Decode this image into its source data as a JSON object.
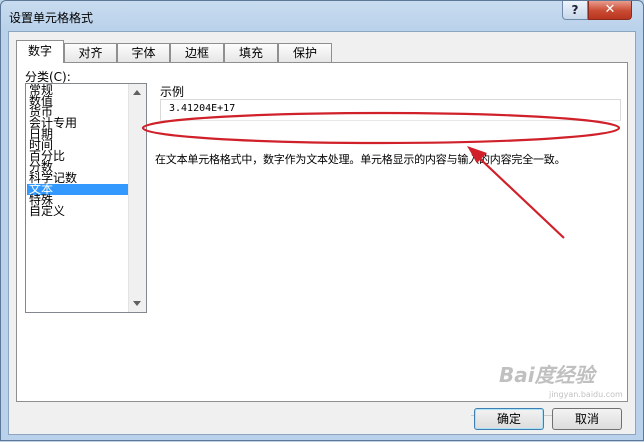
{
  "window": {
    "title": "设置单元格格式",
    "help_glyph": "?",
    "close_glyph": "✕"
  },
  "tabs": [
    {
      "label": "数字",
      "active": true
    },
    {
      "label": "对齐"
    },
    {
      "label": "字体"
    },
    {
      "label": "边框"
    },
    {
      "label": "填充"
    },
    {
      "label": "保护"
    }
  ],
  "category": {
    "label": "分类(C):",
    "items": [
      "常规",
      "数值",
      "货币",
      "会计专用",
      "日期",
      "时间",
      "百分比",
      "分数",
      "科学记数",
      "文本",
      "特殊",
      "自定义"
    ],
    "selected": "文本"
  },
  "sample": {
    "label": "示例",
    "value": "3.41204E+17"
  },
  "description": "在文本单元格格式中，数字作为文本处理。单元格显示的内容与输入的内容完全一致。",
  "buttons": {
    "ok": "确定",
    "cancel": "取消"
  },
  "annotation": {
    "color": "#d0202a"
  },
  "watermark": {
    "text": "Bai度经验",
    "sub": "jingyan.baidu.com"
  }
}
